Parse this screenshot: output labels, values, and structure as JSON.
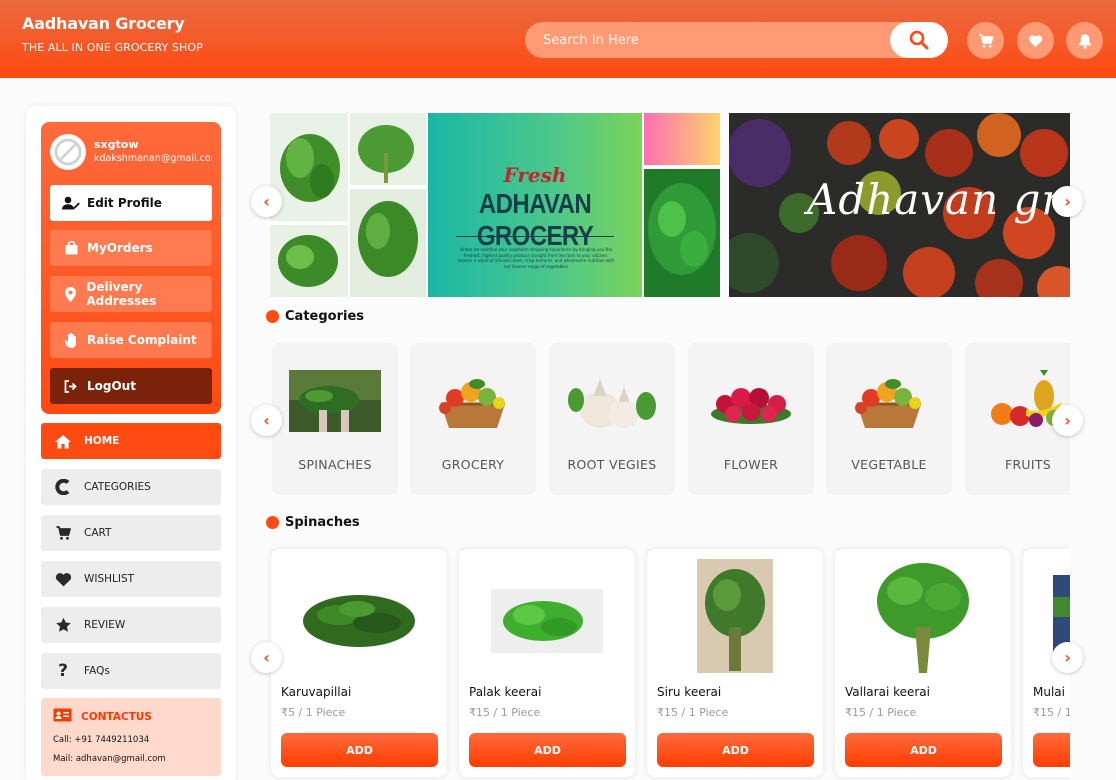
{
  "header": {
    "title": "Aadhavan Grocery",
    "subtitle": "THE ALL IN ONE GROCERY SHOP",
    "search_placeholder": "Search In Here",
    "icons": [
      "search-icon",
      "cart-icon",
      "heart-icon",
      "bell-icon"
    ]
  },
  "profile": {
    "username": "sxgtow",
    "email": "kdakshmanan@gmail.com",
    "buttons": [
      {
        "label": "Edit Profile",
        "icon": "user-edit-icon"
      },
      {
        "label": "MyOrders",
        "icon": "shopping-bag-icon"
      },
      {
        "label": "Delivery Addresses",
        "icon": "location-pin-icon"
      },
      {
        "label": "Raise Complaint",
        "icon": "hand-icon"
      },
      {
        "label": "LogOut",
        "icon": "logout-icon"
      }
    ]
  },
  "nav": [
    {
      "label": "HOME",
      "icon": "home-icon",
      "active": true
    },
    {
      "label": "CATEGORIES",
      "icon": "categories-icon"
    },
    {
      "label": "CART",
      "icon": "cart-icon"
    },
    {
      "label": "WISHLIST",
      "icon": "heart-icon"
    },
    {
      "label": "REVIEW",
      "icon": "star-icon"
    },
    {
      "label": "FAQs",
      "icon": "question-icon"
    }
  ],
  "contact": {
    "title": "CONTACTUS",
    "call": "Call: +91 7449211034",
    "mail": "Mail: adhavan@gmail.com"
  },
  "banners": [
    {
      "script_text": "Fresh",
      "title": "ADHAVAN GROCERY",
      "body": "where we redefine your vegetable shopping experience by bringing you the freshest, highest quality produce straight from the farm to your kitchen. explore a world of vibrant colors, crisp textures, and wholesome nutrition with our diverse range of vegetables"
    },
    {
      "script_text": "Adhavan groce"
    }
  ],
  "categories": {
    "title": "Categories",
    "items": [
      "SPINACHES",
      "GROCERY",
      "ROOT VEGIES",
      "FLOWER",
      "VEGETABLE",
      "FRUITS"
    ]
  },
  "products": {
    "title": "Spinaches",
    "add_label": "ADD",
    "items": [
      {
        "name": "Karuvapillai",
        "price": "₹5 / 1 Piece"
      },
      {
        "name": "Palak keerai",
        "price": "₹15 / 1 Piece"
      },
      {
        "name": "Siru keerai",
        "price": "₹15 / 1 Piece"
      },
      {
        "name": "Vallarai keerai",
        "price": "₹15 / 1 Piece"
      },
      {
        "name": "Mulai",
        "price": "₹15 / 1"
      }
    ]
  },
  "colors": {
    "accent": "#ff4a12",
    "accent_light": "#ff9a75",
    "dark_button": "#7a230a",
    "contact_bg": "#ffd9cb"
  }
}
